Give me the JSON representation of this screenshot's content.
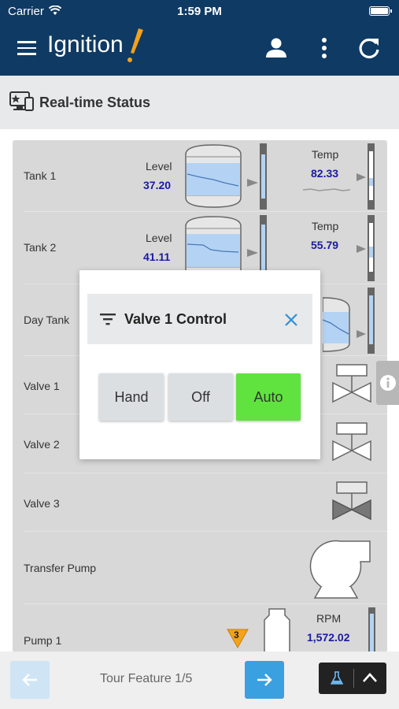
{
  "status": {
    "carrier": "Carrier",
    "time": "1:59 PM"
  },
  "app": {
    "logo_text": "Ignition",
    "colors": {
      "brand": "#0f3a63",
      "accent": "#f4a21b",
      "value": "#1a1aa0",
      "auto": "#61e33f",
      "nav_blue": "#3aa0e0"
    }
  },
  "page": {
    "title": "Real-time Status"
  },
  "rows": {
    "tank1": {
      "label": "Tank 1",
      "level_label": "Level",
      "level_value": "37.20",
      "temp_label": "Temp",
      "temp_value": "82.33"
    },
    "tank2": {
      "label": "Tank 2",
      "level_label": "Level",
      "level_value": "41.11",
      "temp_label": "Temp",
      "temp_value": "55.79"
    },
    "daytank": {
      "label": "Day Tank"
    },
    "valve1": {
      "label": "Valve 1"
    },
    "valve2": {
      "label": "Valve 2"
    },
    "valve3": {
      "label": "Valve 3"
    },
    "pump": {
      "label": "Transfer Pump"
    },
    "pump1": {
      "label": "Pump 1",
      "rpm_label": "RPM",
      "rpm_value": "1,572.02",
      "alarm_count": "3"
    }
  },
  "popup": {
    "title": "Valve 1 Control",
    "buttons": [
      "Hand",
      "Off",
      "Auto"
    ],
    "selected": "Auto"
  },
  "bottom": {
    "tour_text": "Tour Feature 1/5"
  },
  "icons": [
    "wifi-icon",
    "battery-icon",
    "menu-icon",
    "user-icon",
    "more-vert-icon",
    "refresh-icon",
    "monitor-icon",
    "filter-icon",
    "close-icon",
    "info-icon",
    "arrow-left-icon",
    "arrow-right-icon",
    "flask-icon",
    "chevron-up-icon"
  ]
}
